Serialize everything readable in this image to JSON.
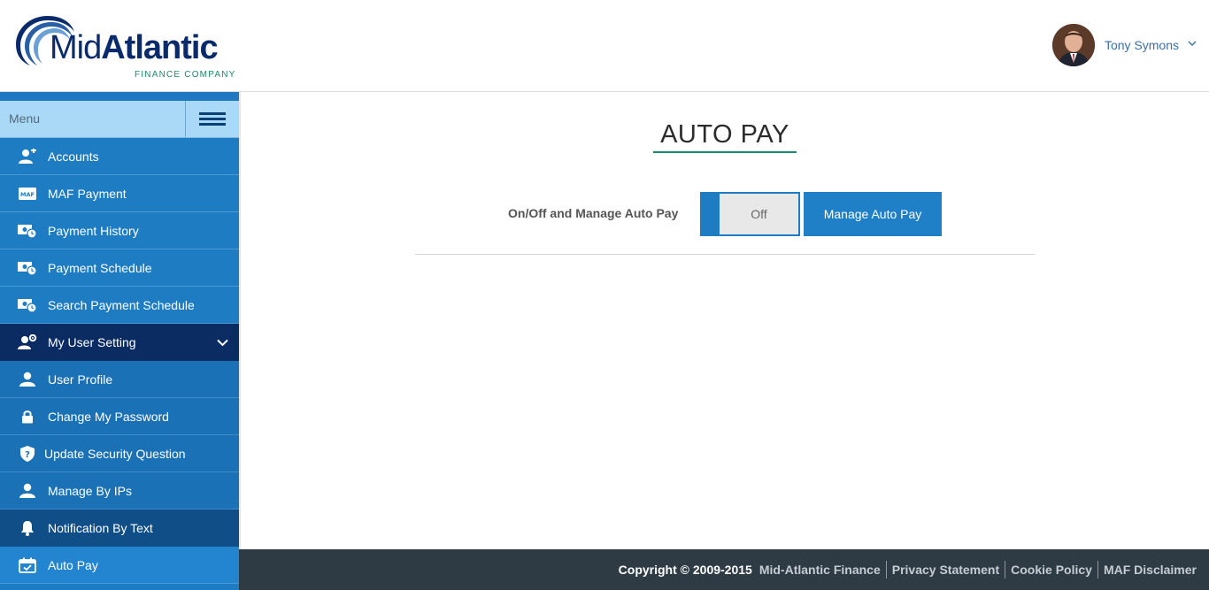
{
  "header": {
    "logo": {
      "brand_light": "Mid",
      "brand_bold": "Atlantic",
      "subtitle": "FINANCE COMPANY"
    },
    "user": {
      "name": "Tony Symons",
      "caret_icon": "chevron-down-icon"
    }
  },
  "sidebar": {
    "menu_label": "Menu",
    "items": [
      {
        "label": "Accounts",
        "icon": "user-add-icon"
      },
      {
        "label": "MAF Payment",
        "icon": "maf-card-icon",
        "icon_text": "MAF"
      },
      {
        "label": "Payment History",
        "icon": "payment-clock-icon"
      },
      {
        "label": "Payment Schedule",
        "icon": "payment-clock-icon"
      },
      {
        "label": "Search Payment Schedule",
        "icon": "payment-clock-icon"
      },
      {
        "label": "My User Setting",
        "icon": "user-gear-icon",
        "expanded": true
      },
      {
        "label": "User Profile",
        "icon": "user-icon"
      },
      {
        "label": "Change My Password",
        "icon": "lock-icon"
      },
      {
        "label": "Update Security Question",
        "icon": "shield-question-icon"
      },
      {
        "label": "Manage By IPs",
        "icon": "user-icon"
      },
      {
        "label": "Notification By Text",
        "icon": "bell-icon",
        "active": true
      },
      {
        "label": "Auto Pay",
        "icon": "calendar-check-icon"
      }
    ]
  },
  "main": {
    "title": "AUTO PAY",
    "autopay": {
      "label": "On/Off and Manage Auto Pay",
      "toggle_state": "Off",
      "manage_button": "Manage Auto Pay"
    }
  },
  "footer": {
    "copyright": "Copyright © 2009-2015",
    "links": [
      "Mid-Atlantic Finance",
      "Privacy Statement",
      "Cookie Policy",
      "MAF Disclaimer"
    ]
  },
  "colors": {
    "brand_navy": "#0a2b6b",
    "brand_green": "#1a8a6e",
    "sidebar_blue": "#1e7cc3",
    "sidebar_group": "#0b2c63",
    "footer_bg": "#2e3b45"
  }
}
